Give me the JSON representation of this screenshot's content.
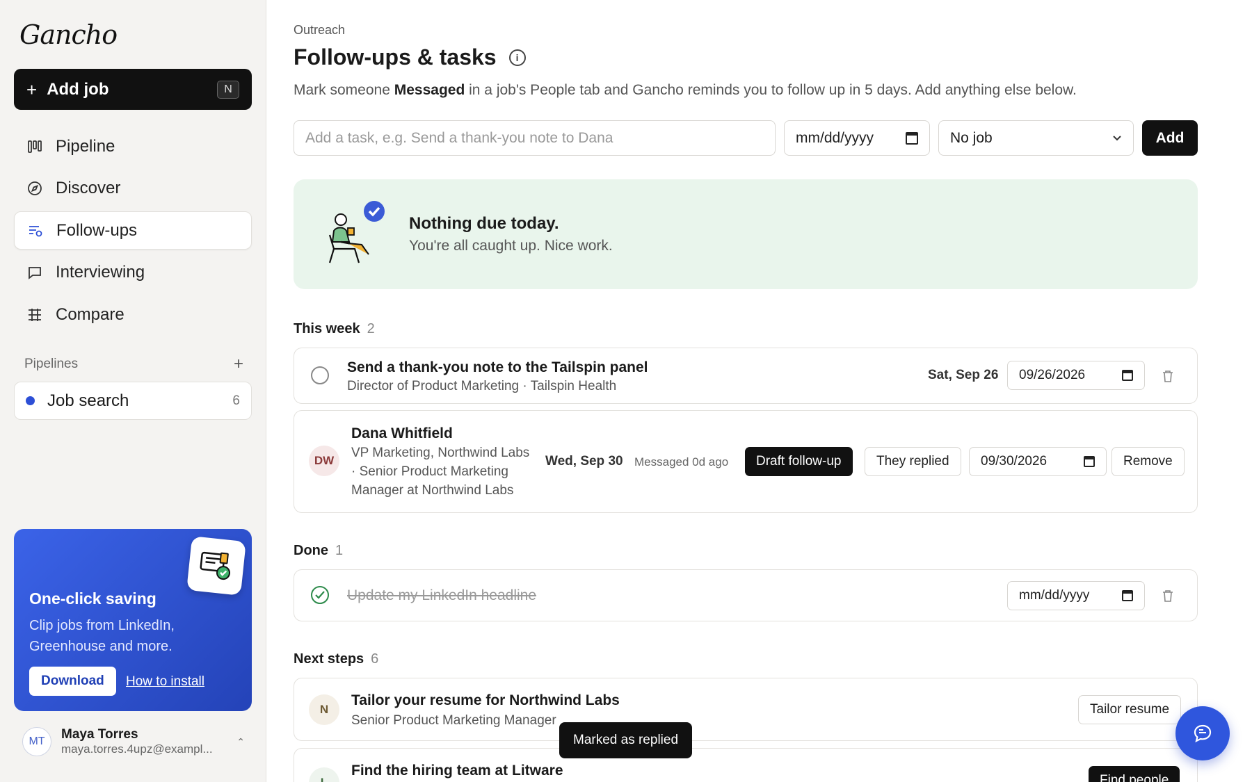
{
  "app": {
    "logo": "Gancho"
  },
  "sidebar": {
    "add_job_label": "Add job",
    "add_job_shortcut": "N",
    "nav": [
      {
        "label": "Pipeline",
        "icon": "pipeline-icon"
      },
      {
        "label": "Discover",
        "icon": "compass-icon"
      },
      {
        "label": "Follow-ups",
        "icon": "follow-ups-icon",
        "active": true
      },
      {
        "label": "Interviewing",
        "icon": "chat-icon"
      },
      {
        "label": "Compare",
        "icon": "compare-icon"
      }
    ],
    "pipelines_heading": "Pipelines",
    "pipeline": {
      "name": "Job search",
      "count": "6",
      "color": "#2d4fd6"
    },
    "promo": {
      "title": "One-click saving",
      "description": "Clip jobs from LinkedIn, Greenhouse and more.",
      "download_label": "Download",
      "install_label": "How to install"
    },
    "user": {
      "initials": "MT",
      "name": "Maya Torres",
      "email": "maya.torres.4upz@exampl..."
    }
  },
  "main": {
    "breadcrumb": "Outreach",
    "title": "Follow-ups & tasks",
    "subtitle_pre": "Mark someone",
    "subtitle_bold": "Messaged",
    "subtitle_post": "in a job's People tab and Gancho reminds you to follow up in 5 days. Add anything else below.",
    "add_row": {
      "task_placeholder": "Add a task, e.g. Send a thank-you note to Dana",
      "date_placeholder": "mm/dd/yyyy",
      "job_selected": "No job",
      "add_label": "Add"
    },
    "empty_state": {
      "title": "Nothing due today.",
      "subtitle": "You're all caught up. Nice work."
    },
    "this_week": {
      "heading": "This week",
      "count": "2",
      "task": {
        "title": "Send a thank-you note to the Tailspin panel",
        "subtitle": "Director of Product Marketing · Tailspin Health",
        "due": "Sat, Sep 26",
        "date": "09/26/2026"
      },
      "person": {
        "initials": "DW",
        "name": "Dana Whitfield",
        "role_line1": "VP Marketing, Northwind Labs",
        "role_line2": "· Senior Product Marketing",
        "role_line3": "Manager at Northwind Labs",
        "due": "Wed, Sep 30",
        "status": "Messaged 0d ago",
        "draft_label": "Draft follow-up",
        "replied_label": "They replied",
        "date": "09/30/2026",
        "remove_label": "Remove"
      }
    },
    "done": {
      "heading": "Done",
      "count": "1",
      "task": {
        "title": "Update my LinkedIn headline",
        "date": "mm/dd/yyyy"
      }
    },
    "next_steps": {
      "heading": "Next steps",
      "count": "6",
      "items": [
        {
          "initial": "N",
          "title": "Tailor your resume for Northwind Labs",
          "subtitle": "Senior Product Marketing Manager",
          "action": "Tailor resume"
        },
        {
          "initial": "L",
          "title": "Find the hiring team at Litware",
          "action": "Find people"
        }
      ]
    },
    "toast": "Marked as replied"
  }
}
